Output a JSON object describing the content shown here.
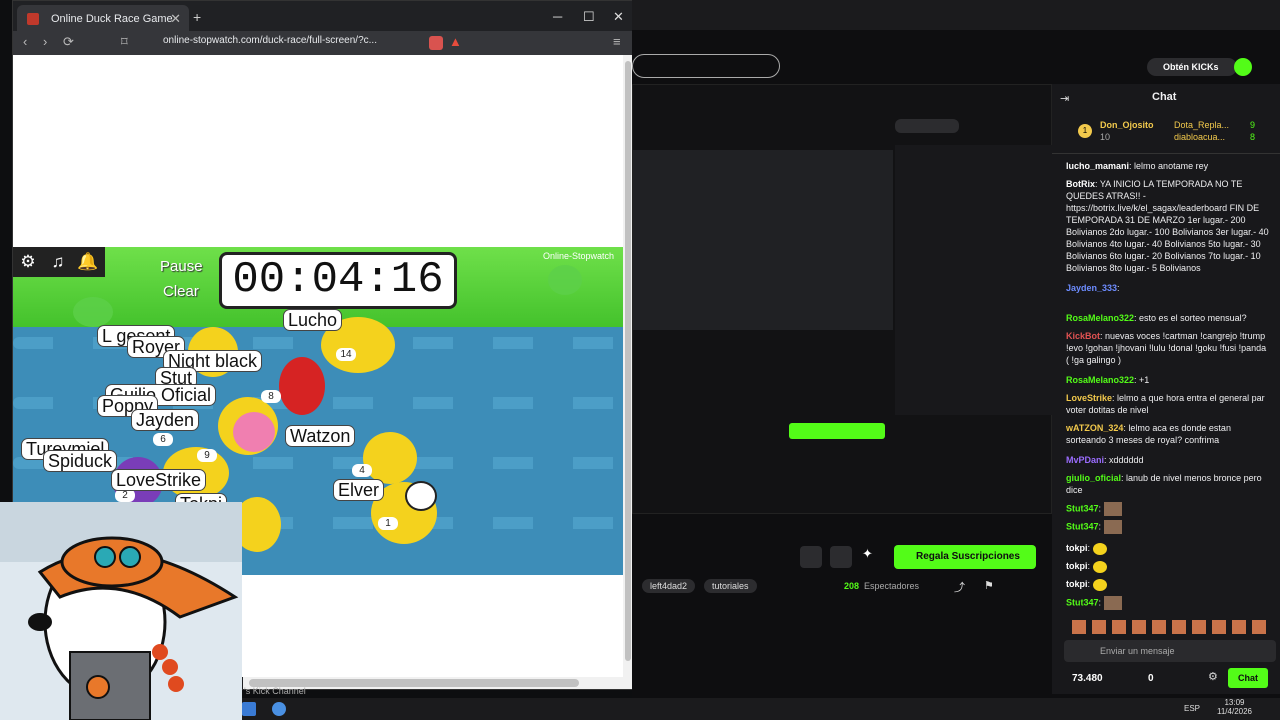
{
  "browser": {
    "tab_title": "Online Duck Race Game",
    "url": "online-stopwatch.com/duck-race/full-screen/?c..."
  },
  "game": {
    "timer": "00:04:16",
    "pause_label": "Pause",
    "clear_label": "Clear",
    "logo_text": "Online-Stopwatch",
    "ducks": [
      {
        "name": "L gesent",
        "number": ""
      },
      {
        "name": "Royer",
        "number": ""
      },
      {
        "name": "Night black",
        "number": ""
      },
      {
        "name": "Stut",
        "number": ""
      },
      {
        "name": "Guilio Oficial",
        "number": "8"
      },
      {
        "name": "Poppy",
        "number": ""
      },
      {
        "name": "Jayden",
        "number": "6"
      },
      {
        "name": "Turevmiel",
        "number": ""
      },
      {
        "name": "Spiduck",
        "number": "9"
      },
      {
        "name": "LoveStrike",
        "number": "2"
      },
      {
        "name": "Tokpi",
        "number": ""
      },
      {
        "name": "Lucho",
        "number": "14"
      },
      {
        "name": "Watzon",
        "number": "4"
      },
      {
        "name": "Elver",
        "number": "1"
      }
    ]
  },
  "stream": {
    "get_kicks": "Obtén KICKs",
    "chat_title": "Chat",
    "top_user": "Don_Ojosito",
    "top_user_count": "10",
    "top2": "Dota_Repla...",
    "top2_count": "9",
    "top3": "diabloacua...",
    "top3_count": "8",
    "tags": [
      "left4dad2",
      "tutoriales"
    ],
    "subs_button": "Regala Suscripciones",
    "viewers": "208",
    "viewers_label": "Espectadores",
    "chat_placeholder": "Enviar un mensaje",
    "points": "73.480",
    "zero": "0",
    "chat_button": "Chat",
    "messages": [
      {
        "user": "lucho_mamani",
        "text": "lelmo anotame rey"
      },
      {
        "user": "BotRix",
        "text": "YA INICIO LA TEMPORADA NO TE QUEDES ATRAS!! - https://botrix.live/k/el_sagax/leaderboard FIN DE TEMPORADA 31 DE MARZO 1er lugar.- 200 Bolivianos 2do lugar.- 100 Bolivianos 3er lugar.- 40 Bolivianos 4to lugar.- 40 Bolivianos 5to lugar.- 30 Bolivianos 6to lugar.- 20 Bolivianos 7to lugar.- 10 Bolivianos 8to lugar.- 5 Bolivianos"
      },
      {
        "user": "Jayden_333",
        "text": ""
      },
      {
        "user": "RosaMelano322",
        "text": "esto es el sorteo mensual?"
      },
      {
        "user": "KickBot",
        "text": "nuevas voces !cartman !cangrejo !trump !evo !gohan !jhovani !lulu !donal !goku !fusi !panda ( !ga galingo )"
      },
      {
        "user": "RosaMelano322",
        "text": "+1"
      },
      {
        "user": "LoveStrike",
        "text": "lelmo a que hora entra el general par voter dotitas de nivel"
      },
      {
        "user": "wATZON_324",
        "text": "lelmo aca es donde estan sorteando 3 meses de royal? confrima"
      },
      {
        "user": "MvPDani",
        "text": "xdddddd"
      },
      {
        "user": "giulio_oficial",
        "text": "lanub de nivel menos bronce pero dice"
      },
      {
        "user": "Stut347",
        "text": ""
      },
      {
        "user": "Stut347",
        "text": ""
      },
      {
        "user": "tokpi",
        "text": ""
      },
      {
        "user": "tokpi",
        "text": ""
      },
      {
        "user": "tokpi",
        "text": ""
      },
      {
        "user": "Stut347",
        "text": ""
      }
    ]
  },
  "taskbar": {
    "lang": "ESP",
    "time": "13:09",
    "date": "11/4/2026",
    "bottom_text": "'s Kick Channel"
  }
}
